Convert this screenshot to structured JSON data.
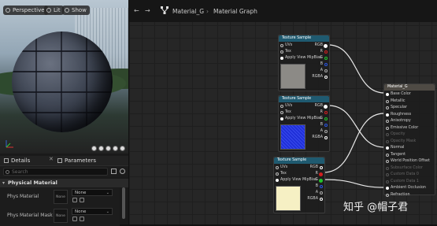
{
  "viewport": {
    "buttons": [
      {
        "label": "Perspective",
        "icon": "perspective-icon"
      },
      {
        "label": "Lit",
        "icon": "lit-icon"
      },
      {
        "label": "Show",
        "icon": "show-icon"
      }
    ]
  },
  "panel": {
    "tabs": [
      {
        "label": "Details",
        "icon": "pencil-icon"
      },
      {
        "label": "Parameters",
        "icon": "parameters-icon"
      }
    ],
    "search_placeholder": "Search",
    "section": "Physical Material",
    "props": [
      {
        "label": "Phys Material",
        "thumb": "None",
        "value": "None"
      },
      {
        "label": "Phys Material Mask",
        "thumb": "None",
        "value": "None"
      }
    ]
  },
  "graph_header": {
    "back": "←",
    "forward": "→",
    "breadcrumb": [
      "Material_G",
      "Material Graph"
    ],
    "separator": "›"
  },
  "nodes": {
    "tex1": {
      "title": "Texture Sample",
      "inputs": [
        "UVs",
        "Tex",
        "Apply View MipBias"
      ],
      "outputs": [
        "RGB",
        "R",
        "G",
        "B",
        "A",
        "RGBA"
      ],
      "preview_color": "#8c8a86"
    },
    "tex2": {
      "title": "Texture Sample",
      "inputs": [
        "UVs",
        "Tex",
        "Apply View MipBias"
      ],
      "outputs": [
        "RGB",
        "R",
        "G",
        "B",
        "A",
        "RGBA"
      ],
      "preview_color": "#1f2fd8"
    },
    "tex3": {
      "title": "Texture Sample",
      "inputs": [
        "UVs",
        "Tex",
        "Apply View MipBias"
      ],
      "outputs": [
        "RGB",
        "R",
        "G",
        "B",
        "A",
        "RGBA"
      ],
      "preview_color": "#f6f0c4"
    },
    "material": {
      "title": "Material_G",
      "inputs": [
        "Base Color",
        "Metallic",
        "Specular",
        "Roughness",
        "Anisotropy",
        "Emissive Color",
        "Opacity",
        "Opacity Mask",
        "Normal",
        "Tangent",
        "World Position Offset",
        "Subsurface Color",
        "Custom Data 0",
        "Custom Data 1",
        "Ambient Occlusion",
        "Refraction"
      ]
    }
  },
  "colors": {
    "wire": "#e8e8e8",
    "pin_r": "#d21f1f",
    "pin_g": "#23c52c",
    "pin_b": "#2a54e0",
    "node_header": "#1f5a70"
  },
  "watermark": "知乎 @帽子君"
}
